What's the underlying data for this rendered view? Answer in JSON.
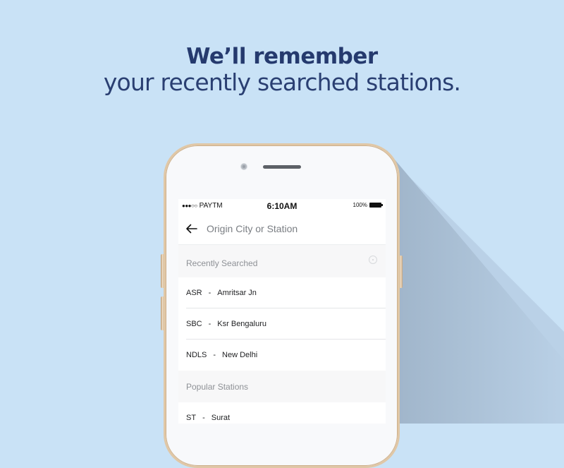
{
  "headline": {
    "line1": "We’ll remember",
    "line2": "your recently searched stations."
  },
  "colors": {
    "background": "#c9e2f6",
    "headline": "#253a6e",
    "phone_frame": "#e0c7a6"
  },
  "phone": {
    "statusbar": {
      "signal_dots": "●●●○○",
      "carrier": "PAYTM",
      "time": "6:10AM",
      "battery_percent": "100%"
    },
    "search": {
      "back_icon": "arrow-left-icon",
      "placeholder": "Origin City or Station",
      "value": ""
    },
    "recent": {
      "title": "Recently Searched",
      "action_icon": "add-circle-icon",
      "items": [
        {
          "code": "ASR",
          "sep": "-",
          "name": "Amritsar Jn"
        },
        {
          "code": "SBC",
          "sep": "-",
          "name": "Ksr Bengaluru"
        },
        {
          "code": "NDLS",
          "sep": "-",
          "name": "New Delhi"
        }
      ]
    },
    "popular": {
      "title": "Popular Stations",
      "items": [
        {
          "code": "ST",
          "sep": "-",
          "name": "Surat"
        }
      ]
    }
  }
}
